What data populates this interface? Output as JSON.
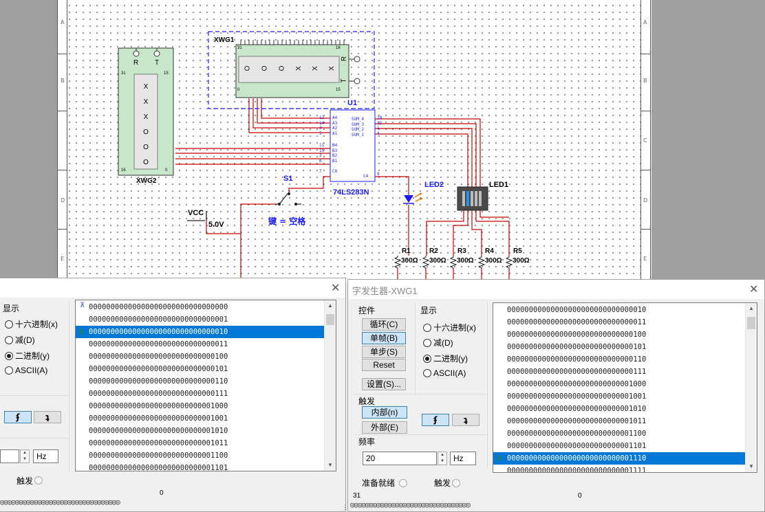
{
  "schematic": {
    "row_letters": [
      "A",
      "B",
      "C",
      "D",
      "E"
    ],
    "xwg1": {
      "name": "XWG1",
      "display": [
        "O",
        "O",
        "O",
        "X",
        "X",
        "X"
      ],
      "pin_hi": "31",
      "pin_hi2": "16",
      "pin_lo": "0",
      "pin_lo2": "15",
      "r": "R",
      "t": "T"
    },
    "xwg2": {
      "name": "XWG2",
      "display": [
        "X",
        "X",
        "X",
        "O",
        "O",
        "O"
      ],
      "r": "R",
      "t": "T",
      "pin_hi": "31",
      "pin_hi2": "15",
      "pin_lo": "16",
      "pin_lo2": "0"
    },
    "u1": {
      "ref": "U1",
      "part": "74LS283N",
      "left_pins": [
        "A4",
        "A3",
        "A2",
        "A1",
        "B4",
        "B3",
        "B2",
        "B1",
        "C0"
      ],
      "left_nums": [
        "12",
        "14",
        "3",
        "5",
        "11",
        "15",
        "2",
        "6",
        "7"
      ],
      "right_pins": [
        "SUM_4",
        "SUM_3",
        "SUM_2",
        "SUM_1",
        "C4"
      ],
      "right_nums": [
        "10",
        "13",
        "1",
        "4",
        "9"
      ]
    },
    "switch": {
      "ref": "S1",
      "key_label": "键 = 空格"
    },
    "vcc": {
      "label": "VCC",
      "value": "5.0V"
    },
    "led2": "LED2",
    "led1": "LED1",
    "resistors": [
      {
        "ref": "R1",
        "value": "300Ω"
      },
      {
        "ref": "R2",
        "value": "300Ω"
      },
      {
        "ref": "R3",
        "value": "300Ω"
      },
      {
        "ref": "R4",
        "value": "300Ω"
      },
      {
        "ref": "R5",
        "value": "300Ω"
      }
    ],
    "colors": {
      "wire": "#cc0000",
      "component": "#1a1aff",
      "chip_body": "#c8e6c9"
    }
  },
  "left_dialog": {
    "display_group": "显示",
    "radios": [
      {
        "label": "十六进制(x)",
        "checked": false
      },
      {
        "label": "减(D)",
        "checked": false
      },
      {
        "label": "二进制(y)",
        "checked": true
      },
      {
        "label": "ASCII(A)",
        "checked": false
      }
    ],
    "edge_rise": "ʄ",
    "edge_fall": "ʇ",
    "freq_unit": "Hz",
    "trigger_label": "触发",
    "pin_zero": "0",
    "pin_strip": "◎◎◎◎◎◎◎◎◎◎◎◎◎◎◎◎◎◎◎◎◎◎◎◎◎◎◎◎◎◎◎◎",
    "rows": [
      "00000000000000000000000000000000",
      "00000000000000000000000000000001",
      "00000000000000000000000000000010",
      "00000000000000000000000000000011",
      "00000000000000000000000000000100",
      "00000000000000000000000000000101",
      "00000000000000000000000000000110",
      "00000000000000000000000000000111",
      "00000000000000000000000000001000",
      "00000000000000000000000000001001",
      "00000000000000000000000000001010",
      "00000000000000000000000000001011",
      "00000000000000000000000000001100",
      "00000000000000000000000000001101"
    ],
    "selected_index": 2
  },
  "right_dialog": {
    "title": "字发生器-XWG1",
    "control_group": "控件",
    "buttons": [
      {
        "label": "循环(C)",
        "active": false
      },
      {
        "label": "单帧(B)",
        "active": true
      },
      {
        "label": "单步(S)",
        "active": false
      },
      {
        "label": "Reset",
        "active": false
      }
    ],
    "settings_button": "设置(S)...",
    "display_group": "显示",
    "radios": [
      {
        "label": "十六进制(x)",
        "checked": false
      },
      {
        "label": "减(D)",
        "checked": false
      },
      {
        "label": "二进制(y)",
        "checked": true
      },
      {
        "label": "ASCII(A)",
        "checked": false
      }
    ],
    "trigger_group": "触发",
    "internal_button": "内部(n)",
    "external_button": "外部(E)",
    "edge_rise": "ʄ",
    "edge_fall": "ʇ",
    "freq_group": "频率",
    "freq_value": "20",
    "freq_unit": "Hz",
    "ready_label": "准备就绪",
    "trigger_label": "触发",
    "pin_hi": "31",
    "pin_zero": "0",
    "pin_strip": "◎◎◎◎◎◎◎◎◎◎◎◎◎◎◎◎◎◎◎◎◎◎◎◎◎◎◎◎◎◎◎◎",
    "rows": [
      "00000000000000000000000000000010",
      "00000000000000000000000000000011",
      "00000000000000000000000000000100",
      "00000000000000000000000000000101",
      "00000000000000000000000000000110",
      "00000000000000000000000000000111",
      "00000000000000000000000000001000",
      "00000000000000000000000000001001",
      "00000000000000000000000000001010",
      "00000000000000000000000000001011",
      "00000000000000000000000000001100",
      "00000000000000000000000000001101",
      "00000000000000000000000000001110",
      "00000000000000000000000000001111"
    ],
    "selected_index": 12
  }
}
